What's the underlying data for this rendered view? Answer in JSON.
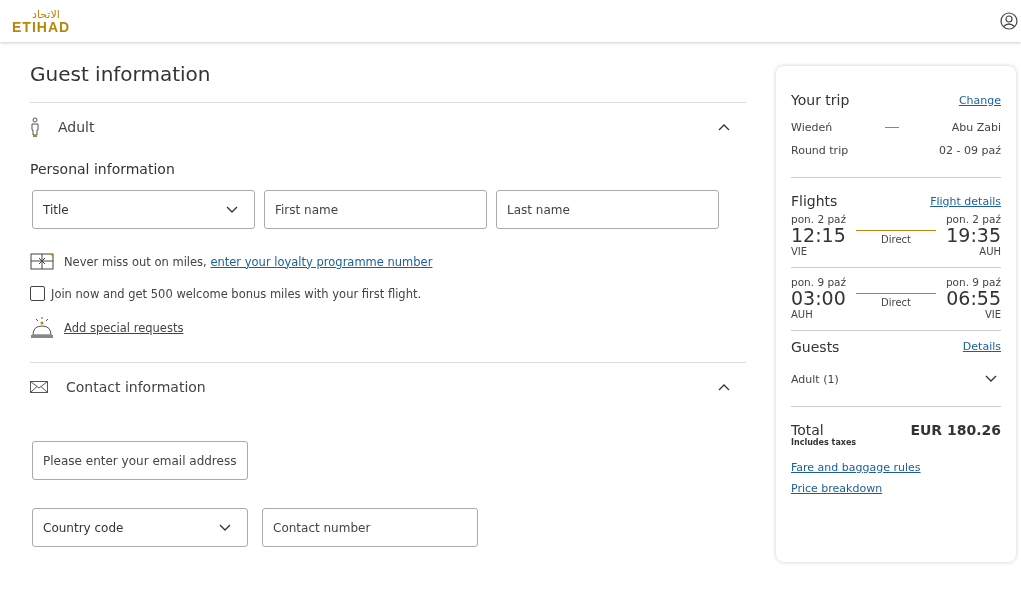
{
  "logo": {
    "arabic": "الاتحاد",
    "latin": "ETIHAD"
  },
  "page_title": "Guest information",
  "guest_section": {
    "label": "Adult",
    "expanded": true
  },
  "personal": {
    "heading": "Personal information",
    "fields": [
      {
        "kind": "select",
        "placeholder": "Title"
      },
      {
        "kind": "text",
        "placeholder": "First name"
      },
      {
        "kind": "text",
        "placeholder": "Last name"
      }
    ]
  },
  "loyalty": {
    "text": "Never miss out on miles,",
    "link": "enter your loyalty programme number"
  },
  "join": {
    "label": "Join now and get 500 welcome bonus miles with your first flight.",
    "checked": false
  },
  "special_requests": "Add special requests",
  "contact_section": {
    "label": "Contact information",
    "expanded": true
  },
  "contact_fields": [
    [
      {
        "kind": "text",
        "placeholder": "Please enter your email address"
      }
    ],
    [
      {
        "kind": "select",
        "placeholder": "Country code"
      },
      {
        "kind": "text",
        "placeholder": "Contact number"
      }
    ]
  ],
  "summary": {
    "trip_title": "Your trip",
    "change_link": "Change",
    "origin": "Wiedeń",
    "destination": "Abu Zabi",
    "trip_type": "Round trip",
    "dates": "02 - 09 paź",
    "flights_title": "Flights",
    "flight_details_link": "Flight details",
    "flights": [
      {
        "dep_date": "pon. 2 paź",
        "dep_time": "12:15",
        "dep_code": "VIE",
        "stops": "Direct",
        "arr_date": "pon. 2 paź",
        "arr_time": "19:35",
        "arr_code": "AUH"
      },
      {
        "dep_date": "pon. 9 paź",
        "dep_time": "03:00",
        "dep_code": "AUH",
        "stops": "Direct",
        "arr_date": "pon. 9 paź",
        "arr_time": "06:55",
        "arr_code": "VIE"
      }
    ],
    "guests_title": "Guests",
    "guests_link": "Details",
    "guests": [
      {
        "label": "Adult (1)",
        "expanded": false
      }
    ],
    "total_label": "Total",
    "total_note": "Includes taxes",
    "total_amount": "EUR 180.26",
    "links": [
      "Fare and baggage rules",
      "Price breakdown"
    ]
  }
}
